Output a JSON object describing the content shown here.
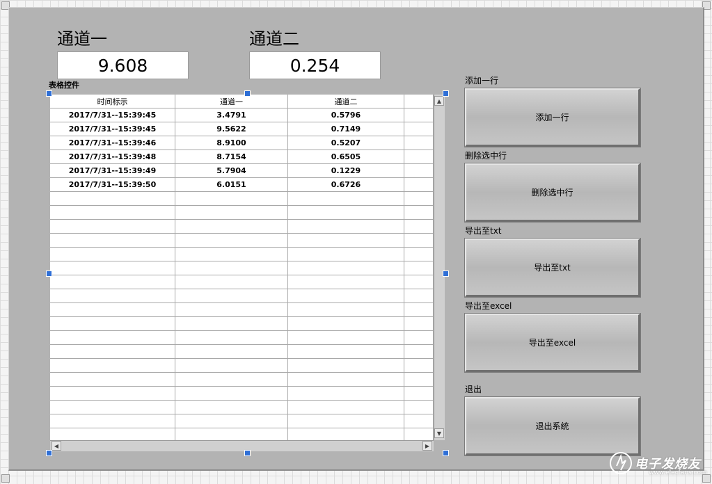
{
  "indicators": [
    {
      "label": "通道一",
      "value": "9.608"
    },
    {
      "label": "通道二",
      "value": "0.254"
    }
  ],
  "table": {
    "label": "表格控件",
    "headers": [
      "时间标示",
      "通道一",
      "通道二",
      ""
    ],
    "rows": [
      [
        "2017/7/31--15:39:45",
        "3.4791",
        "0.5796"
      ],
      [
        "2017/7/31--15:39:45",
        "9.5622",
        "0.7149"
      ],
      [
        "2017/7/31--15:39:46",
        "8.9100",
        "0.5207"
      ],
      [
        "2017/7/31--15:39:48",
        "8.7154",
        "0.6505"
      ],
      [
        "2017/7/31--15:39:49",
        "5.7904",
        "0.1229"
      ],
      [
        "2017/7/31--15:39:50",
        "6.0151",
        "0.6726"
      ]
    ]
  },
  "buttons": [
    {
      "caption": "添加一行",
      "label": "添加一行"
    },
    {
      "caption": "删除选中行",
      "label": "删除选中行"
    },
    {
      "caption": "导出至txt",
      "label": "导出至txt"
    },
    {
      "caption": "导出至excel",
      "label": "导出至excel"
    },
    {
      "caption": "退出",
      "label": "退出系统"
    }
  ],
  "watermark": {
    "text": "电子发烧友",
    "url": "www.elecfans.com"
  },
  "colors": {
    "panel": "#b3b3b3",
    "selection_handle": "#2f6fd6"
  }
}
